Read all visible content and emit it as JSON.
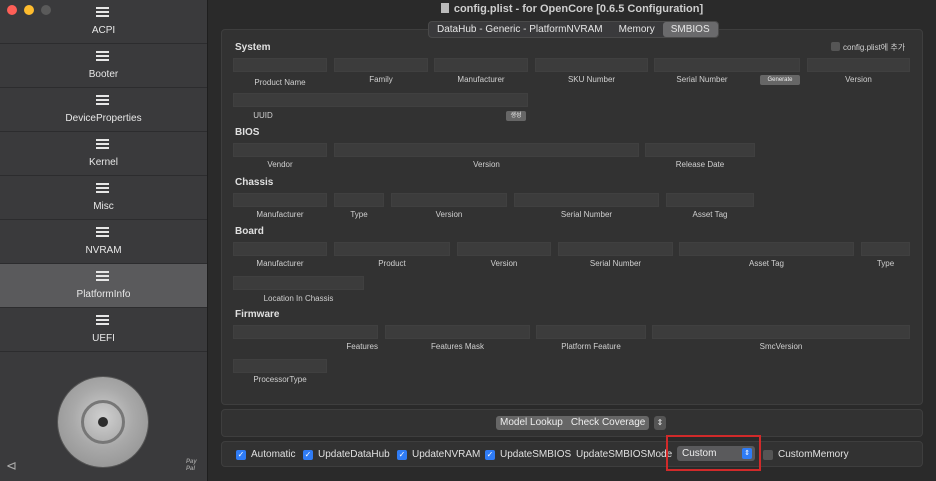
{
  "window": {
    "title": "config.plist - for OpenCore [0.6.5 Configuration]"
  },
  "sidebar": {
    "items": [
      {
        "label": "ACPI",
        "selected": false
      },
      {
        "label": "Booter",
        "selected": false
      },
      {
        "label": "DeviceProperties",
        "selected": false
      },
      {
        "label": "Kernel",
        "selected": false
      },
      {
        "label": "Misc",
        "selected": false
      },
      {
        "label": "NVRAM",
        "selected": false
      },
      {
        "label": "PlatformInfo",
        "selected": true
      },
      {
        "label": "UEFI",
        "selected": false
      }
    ],
    "paypal_label": "Pay Pal"
  },
  "tabs": [
    "DataHub - Generic - PlatformNVRAM",
    "Memory",
    "SMBIOS"
  ],
  "active_tab": "SMBIOS",
  "system": {
    "heading": "System",
    "add_checkbox_label": "config.plist에 추가",
    "labels": {
      "product_name": "Product Name",
      "family": "Family",
      "manufacturer": "Manufacturer",
      "sku": "SKU Number",
      "serial": "Serial Number",
      "version": "Version",
      "uuid": "UUID"
    },
    "generate_button": "Generate",
    "uuid_button": "생성"
  },
  "bios": {
    "heading": "BIOS",
    "labels": {
      "vendor": "Vendor",
      "version": "Version",
      "release_date": "Release Date"
    }
  },
  "chassis": {
    "heading": "Chassis",
    "labels": {
      "manufacturer": "Manufacturer",
      "type": "Type",
      "version": "Version",
      "serial": "Serial Number",
      "asset_tag": "Asset Tag"
    }
  },
  "board": {
    "heading": "Board",
    "labels": {
      "manufacturer": "Manufacturer",
      "product": "Product",
      "version": "Version",
      "serial": "Serial Number",
      "asset_tag": "Asset Tag",
      "type": "Type",
      "location": "Location In Chassis"
    }
  },
  "firmware": {
    "heading": "Firmware",
    "labels": {
      "features": "Features",
      "features_mask": "Features Mask",
      "platform_feature": "Platform Feature",
      "smc_version": "SmcVersion",
      "processor_type": "ProcessorType"
    }
  },
  "actions": {
    "model_lookup": "Model Lookup",
    "check_coverage": "Check Coverage"
  },
  "options": {
    "automatic": "Automatic",
    "update_datahub": "UpdateDataHub",
    "update_nvram": "UpdateNVRAM",
    "update_smbios": "UpdateSMBIOS",
    "smbios_mode_label": "UpdateSMBIOSMode",
    "smbios_mode_value": "Custom",
    "custom_memory": "CustomMemory"
  },
  "colors": {
    "accent": "#2f7cf6",
    "highlight": "#d12a2a"
  }
}
